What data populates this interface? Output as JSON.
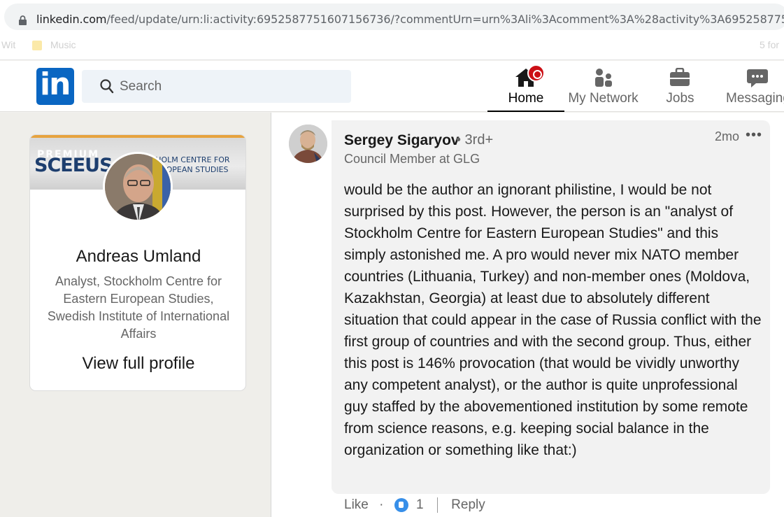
{
  "browser": {
    "url_main": "linkedin.com",
    "url_rest": "/feed/update/urn:li:activity:6952587751607156736/?commentUrn=urn%3Ali%3Acomment%3A%28activity%3A6952587751607",
    "bookmark_left_1": "Wit",
    "bookmark_left_2": "Music",
    "bookmark_right": "5 for"
  },
  "nav": {
    "logo": "in",
    "search_placeholder": "Search",
    "items": [
      {
        "label": "Home",
        "icon": "home-icon"
      },
      {
        "label": "My Network",
        "icon": "network-icon"
      },
      {
        "label": "Jobs",
        "icon": "briefcase-icon"
      },
      {
        "label": "Messaging",
        "icon": "messaging-icon"
      }
    ]
  },
  "profile_card": {
    "banner_premium": "PREMIUM",
    "banner_logo": "SCEEUS",
    "banner_line1": "KHOLM CENTRE FOR",
    "banner_line2": "EUROPEAN STUDIES",
    "name": "Andreas Umland",
    "headline": "Analyst, Stockholm Centre for Eastern European Studies, Swedish Institute of International Affairs",
    "view_profile": "View full profile"
  },
  "comment": {
    "author": "Sergey Sigaryov",
    "degree": "• 3rd+",
    "author_title": "Council Member at GLG",
    "time": "2mo",
    "more": "•••",
    "text": "would be the author an ignorant philistine, I would be not surprised by this post. However, the person is an \"analyst of Stockholm Centre for Eastern European Studies\" and this simply astonished me. A pro would never mix NATO member countries (Lithuania, Turkey) and non-member ones (Moldova, Kazakhstan, Georgia) at least due to absolutely different situation that could appear in the case of Russia conflict with the first group of countries and with the second group. Thus, either this post is 146% provocation (that would be vividly unworthy any competent analyst), or the author is quite unprofessional guy staffed by the abovementioned institution by some remote from science reasons, e.g. keeping social balance in the organization or something like that:)",
    "like_label": "Like",
    "dot": "·",
    "like_count": "1",
    "reply_label": "Reply"
  },
  "colors": {
    "linkedin_blue": "#0a66c2",
    "notification_red": "#cc1016",
    "like_blue": "#378fe9"
  }
}
